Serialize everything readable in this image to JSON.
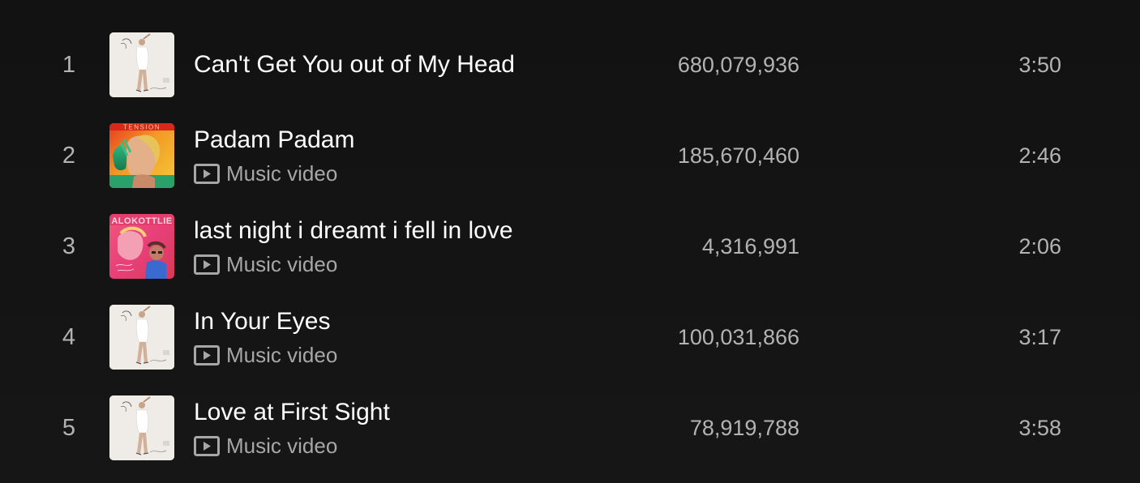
{
  "tracks": [
    {
      "number": "1",
      "title": "Can't Get You out of My Head",
      "subtitle": "",
      "plays": "680,079,936",
      "duration": "3:50",
      "cover": "fever-album-cover"
    },
    {
      "number": "2",
      "title": "Padam Padam",
      "subtitle": "Music video",
      "plays": "185,670,460",
      "duration": "2:46",
      "cover": "tension-album-cover"
    },
    {
      "number": "3",
      "title": "last night i dreamt i fell in love",
      "subtitle": "Music video",
      "plays": "4,316,991",
      "duration": "2:06",
      "cover": "single-cover-pink"
    },
    {
      "number": "4",
      "title": "In Your Eyes",
      "subtitle": "Music video",
      "plays": "100,031,866",
      "duration": "3:17",
      "cover": "fever-album-cover"
    },
    {
      "number": "5",
      "title": "Love at First Sight",
      "subtitle": "Music video",
      "plays": "78,919,788",
      "duration": "3:58",
      "cover": "fever-album-cover"
    }
  ],
  "colors": {
    "background": "#121212",
    "primary_text": "#ffffff",
    "secondary_text": "#b3b3b3"
  }
}
